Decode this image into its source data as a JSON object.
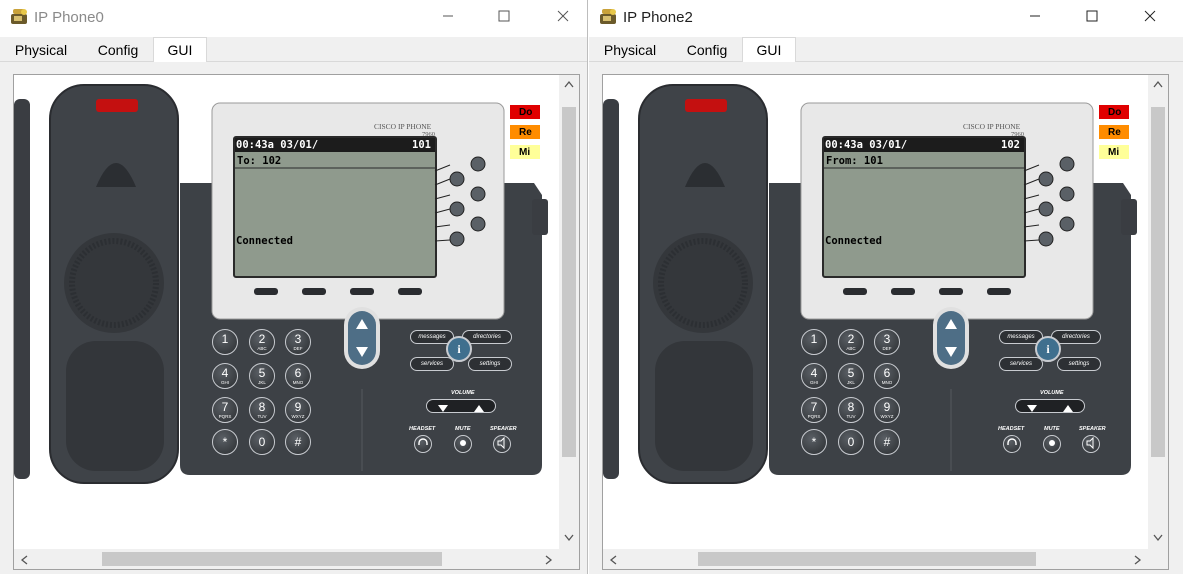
{
  "windows": [
    {
      "title": "IP Phone0",
      "tabs": [
        "Physical",
        "Config",
        "GUI"
      ],
      "active_tab": "GUI",
      "phone": {
        "brand": "CISCO IP PHONE",
        "model": "7960",
        "lcd_time": "00:43a 03/01/",
        "lcd_ext": "101",
        "lcd_line2": "To: 102",
        "lcd_status": "Connected",
        "side_buttons": [
          "Do",
          "Re",
          "Mi"
        ],
        "feature_buttons": [
          "messages",
          "directories",
          "services",
          "settings"
        ],
        "info_label": "i",
        "volume_label": "VOLUME",
        "headset_label": "HEADSET",
        "mute_label": "MUTE",
        "speaker_label": "SPEAKER"
      }
    },
    {
      "title": "IP Phone2",
      "tabs": [
        "Physical",
        "Config",
        "GUI"
      ],
      "active_tab": "GUI",
      "phone": {
        "brand": "CISCO IP PHONE",
        "model": "7960",
        "lcd_time": "00:43a 03/01/",
        "lcd_ext": "102",
        "lcd_line2": "From: 101",
        "lcd_status": "Connected",
        "side_buttons": [
          "Do",
          "Re",
          "Mi"
        ],
        "feature_buttons": [
          "messages",
          "directories",
          "services",
          "settings"
        ],
        "info_label": "i",
        "volume_label": "VOLUME",
        "headset_label": "HEADSET",
        "mute_label": "MUTE",
        "speaker_label": "SPEAKER"
      }
    }
  ],
  "keypad": [
    {
      "digit": "1",
      "letters": ""
    },
    {
      "digit": "2",
      "letters": "ABC"
    },
    {
      "digit": "3",
      "letters": "DEF"
    },
    {
      "digit": "4",
      "letters": "GHI"
    },
    {
      "digit": "5",
      "letters": "JKL"
    },
    {
      "digit": "6",
      "letters": "MNO"
    },
    {
      "digit": "7",
      "letters": "PQRS"
    },
    {
      "digit": "8",
      "letters": "TUV"
    },
    {
      "digit": "9",
      "letters": "WXYZ"
    },
    {
      "digit": "*",
      "letters": ""
    },
    {
      "digit": "0",
      "letters": ""
    },
    {
      "digit": "#",
      "letters": ""
    }
  ],
  "colors": {
    "do": "#e00000",
    "re": "#ff8c00",
    "mi": "#ffff99",
    "lcd_bg": "#8f9a8d",
    "lcd_bar": "#1c1c1c",
    "body": "#3d4146"
  },
  "icons": {
    "app": "ip-phone-icon",
    "minimize": "minimize-icon",
    "maximize": "maximize-icon",
    "close": "close-icon"
  }
}
